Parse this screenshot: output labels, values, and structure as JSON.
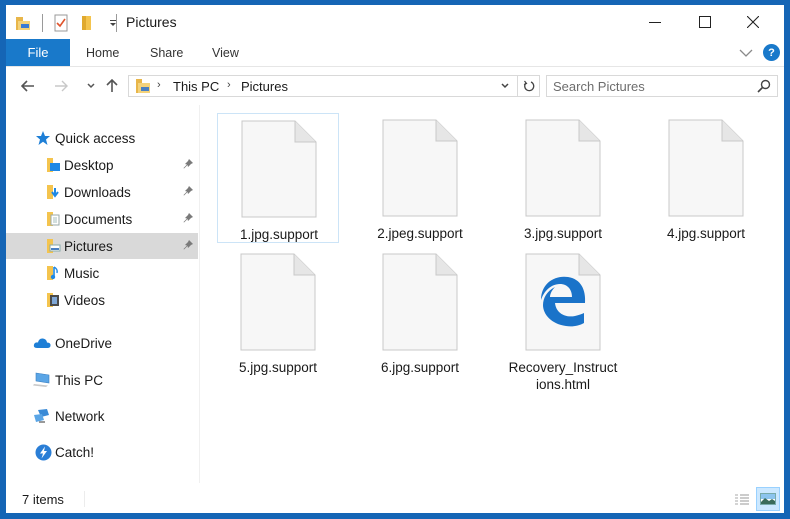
{
  "window": {
    "title": "Pictures",
    "controls": {
      "minimize": "minimize",
      "maximize": "maximize",
      "close": "close"
    }
  },
  "quick_access_toolbar": [
    "folder-properties-icon",
    "checkmark-properties-icon",
    "new-folder-icon",
    "customize-dropdown-icon"
  ],
  "ribbon": {
    "tabs": [
      {
        "label": "File",
        "active": true
      },
      {
        "label": "Home"
      },
      {
        "label": "Share"
      },
      {
        "label": "View"
      }
    ],
    "help_label": "?"
  },
  "navigation": {
    "breadcrumb": [
      "This PC",
      "Pictures"
    ],
    "search_placeholder": "Search Pictures"
  },
  "sidebar": {
    "items": [
      {
        "label": "Quick access",
        "icon": "star-icon",
        "level": 0
      },
      {
        "label": "Desktop",
        "icon": "desktop-folder-icon",
        "level": 1,
        "pinned": true
      },
      {
        "label": "Downloads",
        "icon": "downloads-folder-icon",
        "level": 1,
        "pinned": true
      },
      {
        "label": "Documents",
        "icon": "documents-folder-icon",
        "level": 1,
        "pinned": true
      },
      {
        "label": "Pictures",
        "icon": "pictures-folder-icon",
        "level": 1,
        "pinned": true,
        "selected": true
      },
      {
        "label": "Music",
        "icon": "music-folder-icon",
        "level": 1
      },
      {
        "label": "Videos",
        "icon": "videos-folder-icon",
        "level": 1
      },
      {
        "label": "OneDrive",
        "icon": "onedrive-cloud-icon",
        "level": 0
      },
      {
        "label": "This PC",
        "icon": "computer-icon",
        "level": 0
      },
      {
        "label": "Network",
        "icon": "network-icon",
        "level": 0
      },
      {
        "label": "Catch!",
        "icon": "catch-icon",
        "level": 0
      }
    ]
  },
  "files": [
    {
      "name": "1.jpg.support",
      "type": "blank-file",
      "selected": true
    },
    {
      "name": "2.jpeg.support",
      "type": "blank-file"
    },
    {
      "name": "3.jpg.support",
      "type": "blank-file"
    },
    {
      "name": "4.jpg.support",
      "type": "blank-file"
    },
    {
      "name": "5.jpg.support",
      "type": "blank-file"
    },
    {
      "name": "6.jpg.support",
      "type": "blank-file"
    },
    {
      "name": "Recovery_Instructions.html",
      "name_line1": "Recovery_Instruct",
      "name_line2": "ions.html",
      "type": "edge-html-file"
    }
  ],
  "statusbar": {
    "item_count": "7 items"
  },
  "colors": {
    "accent": "#1979ca",
    "window_border": "#1565b5",
    "selection": "#d9d9d9",
    "edge_blue": "#1a73c9"
  }
}
